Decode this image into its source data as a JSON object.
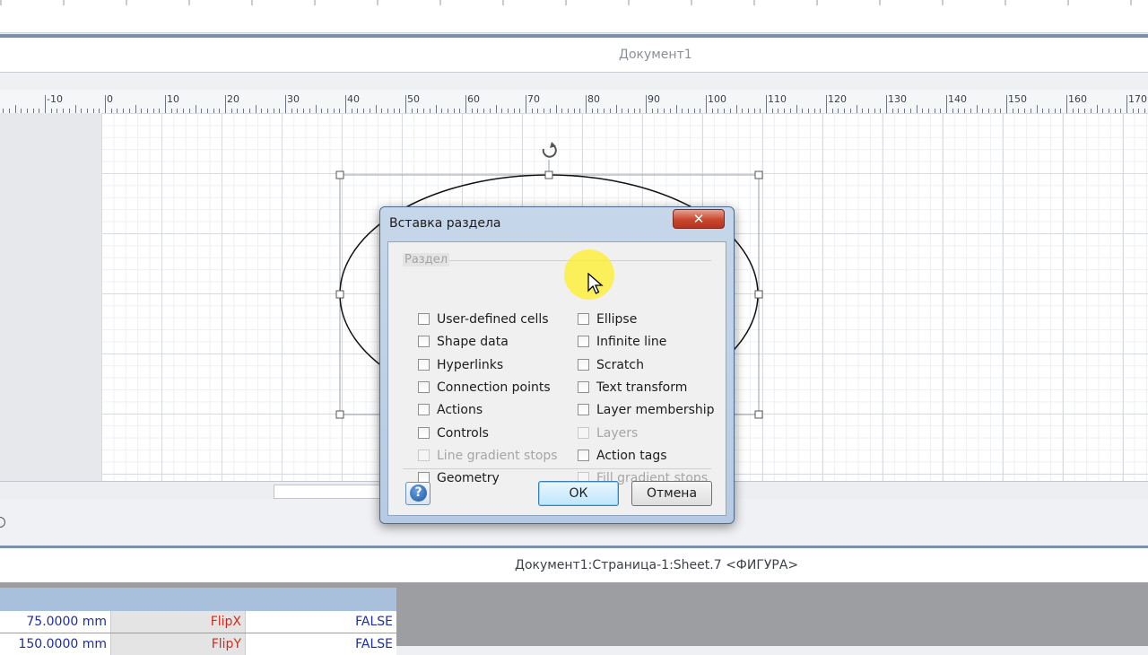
{
  "document": {
    "title": "Документ1"
  },
  "ruler": {
    "labels": [
      "-10",
      "0",
      "10",
      "20",
      "30",
      "40",
      "50",
      "60",
      "70",
      "80",
      "90",
      "100",
      "110",
      "120",
      "130",
      "140",
      "150",
      "160",
      "170"
    ]
  },
  "dialog": {
    "title": "Вставка раздела",
    "close_label": "✕",
    "group_label": "Раздел",
    "left_column": [
      {
        "label": "User-defined cells",
        "enabled": true
      },
      {
        "label": "Shape data",
        "enabled": true
      },
      {
        "label": "Hyperlinks",
        "enabled": true
      },
      {
        "label": "Connection points",
        "enabled": true
      },
      {
        "label": "Actions",
        "enabled": true
      },
      {
        "label": "Controls",
        "enabled": true
      },
      {
        "label": "Line gradient stops",
        "enabled": false
      },
      {
        "label": "Geometry",
        "enabled": true
      }
    ],
    "right_column": [
      {
        "label": "Ellipse",
        "enabled": true
      },
      {
        "label": "Infinite line",
        "enabled": true
      },
      {
        "label": "Scratch",
        "enabled": true
      },
      {
        "label": "Text transform",
        "enabled": true
      },
      {
        "label": "Layer membership",
        "enabled": true
      },
      {
        "label": "Layers",
        "enabled": false
      },
      {
        "label": "Action tags",
        "enabled": true
      },
      {
        "label": "Fill gradient stops",
        "enabled": false
      }
    ],
    "help_label": "?",
    "ok_label": "ОК",
    "cancel_label": "Отмена"
  },
  "shapesheet": {
    "title": "Документ1:Страница-1:Sheet.7 <ФИГУРА>",
    "rows": [
      {
        "value": "75.0000 mm",
        "cell": "FlipX",
        "result": "FALSE"
      },
      {
        "value": "150.0000 mm",
        "cell": "FlipY",
        "result": "FALSE"
      }
    ]
  },
  "colors": {
    "accent_border": "#7c8ea8",
    "cell_name": "#d12a1f",
    "cell_value": "#1d2ea0",
    "close_button": "#c9462d"
  }
}
